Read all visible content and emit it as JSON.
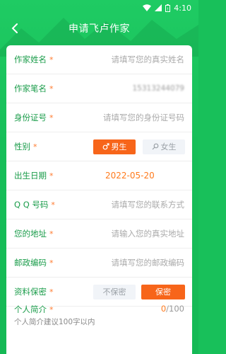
{
  "status": {
    "time": "4:10"
  },
  "nav": {
    "title": "申请飞卢作家"
  },
  "form": {
    "name": {
      "label": "作家姓名",
      "placeholder": "请填写您的真实姓名"
    },
    "pen_name": {
      "label": "作家笔名",
      "value": "15313244079"
    },
    "id_number": {
      "label": "身份证号",
      "placeholder": "请填写您的身份证号码"
    },
    "gender": {
      "label": "性别",
      "options": [
        "男生",
        "女生"
      ],
      "selected": "男生"
    },
    "birthday": {
      "label": "出生日期",
      "value": "2022-05-20"
    },
    "qq": {
      "label": "Q Q 号码",
      "placeholder": "请填写您的联系方式"
    },
    "address": {
      "label": "您的地址",
      "placeholder": "请输入您的真实地址"
    },
    "postcode": {
      "label": "邮政编码",
      "placeholder": "请填写您的邮政编码"
    },
    "privacy": {
      "label": "资料保密",
      "options": [
        "不保密",
        "保密"
      ],
      "selected": "保密"
    },
    "intro": {
      "label": "个人简介",
      "count": "0",
      "max": "/100",
      "hint": "个人简介建议100字以内"
    }
  },
  "required_mark": "*",
  "colors": {
    "header_green": "#18c05a",
    "label_green": "#1a9c4a",
    "accent_orange": "#f7651a"
  }
}
